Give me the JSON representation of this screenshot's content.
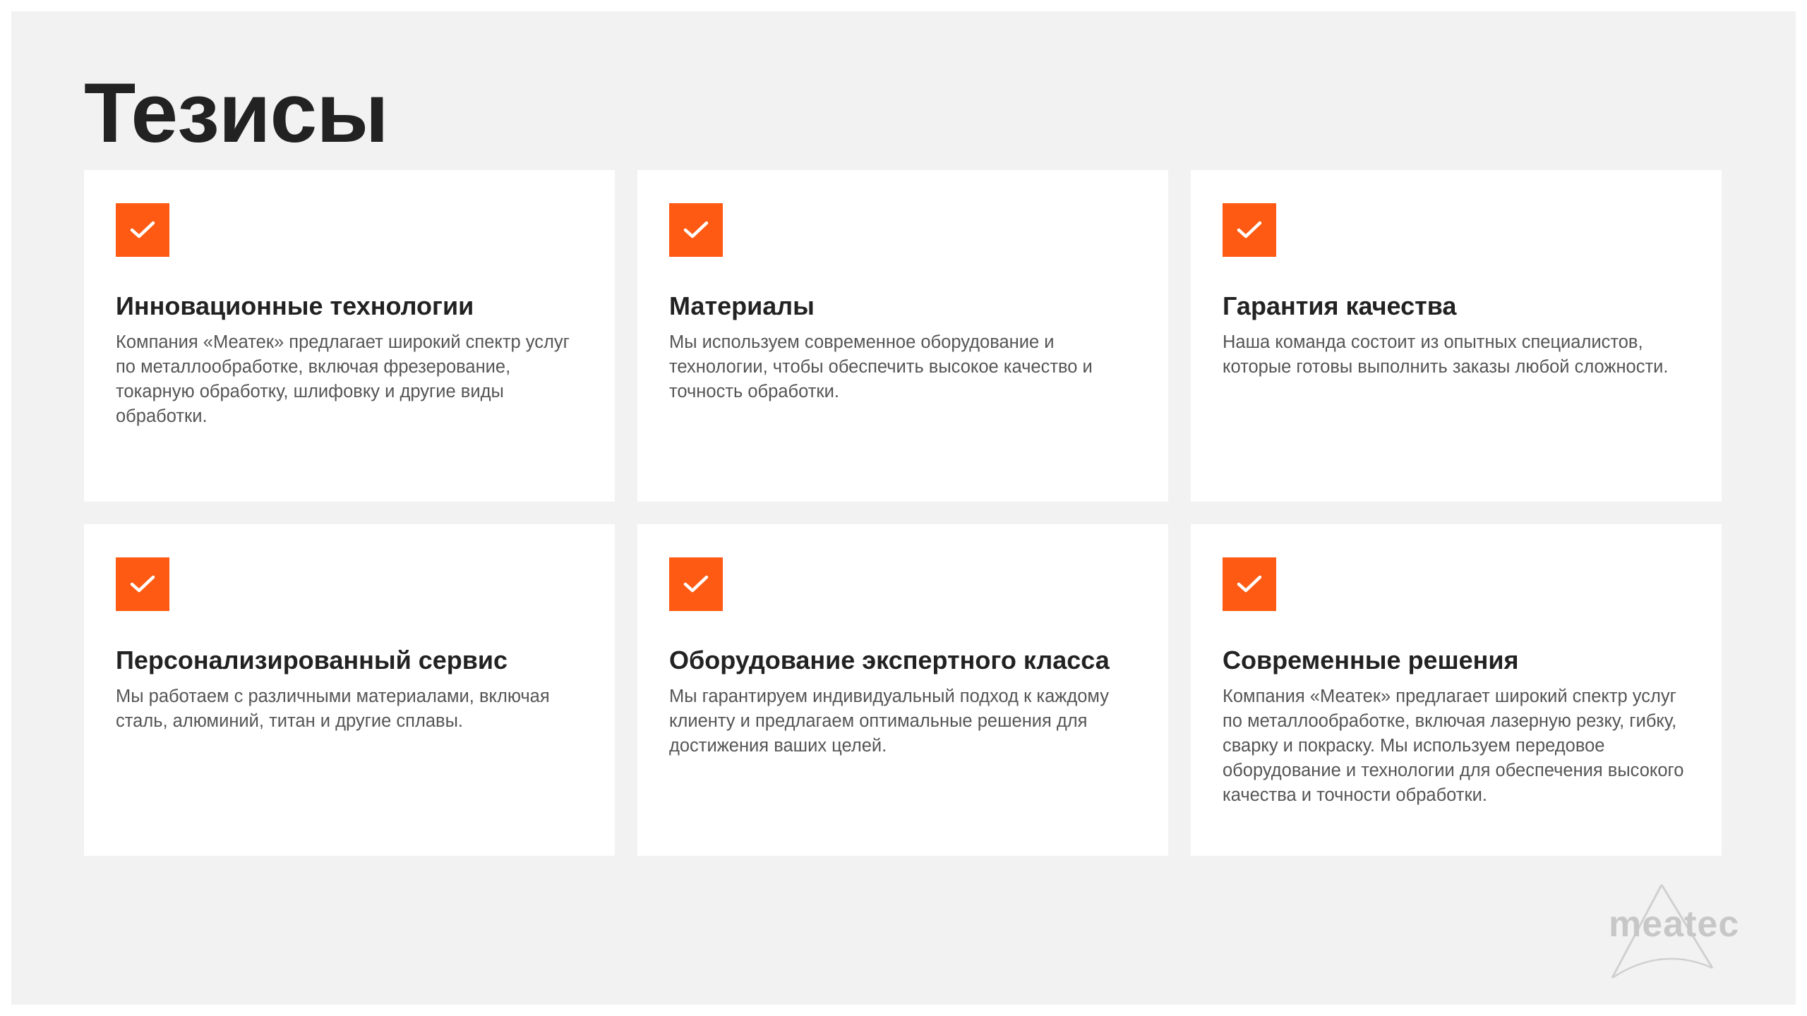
{
  "slide": {
    "title": "Тезисы"
  },
  "theme": {
    "accent": "#fe5a13",
    "background": "#f2f2f2",
    "card": "#ffffff",
    "title_color": "#222222",
    "text_color": "#555555",
    "logo_color": "#c7c7c7"
  },
  "cards": [
    {
      "icon": "checkmark-icon",
      "title": "Инновационные технологии",
      "text": "Компания «Меатек» предлагает широкий спектр услуг по металлообработке, включая фрезерование, токарную обработку, шлифовку и другие виды обработки."
    },
    {
      "icon": "checkmark-icon",
      "title": "Материалы",
      "text": "Мы используем современное оборудование и технологии, чтобы обеспечить высокое качество и точность обработки."
    },
    {
      "icon": "checkmark-icon",
      "title": "Гарантия качества",
      "text": "Наша команда состоит из опытных специалистов, которые готовы выполнить заказы любой сложности."
    },
    {
      "icon": "checkmark-icon",
      "title": "Персонализированный сервис",
      "text": "Мы работаем с различными материалами, включая сталь, алюминий, титан и другие сплавы."
    },
    {
      "icon": "checkmark-icon",
      "title": "Оборудование экспертного класса",
      "text": "Мы гарантируем индивидуальный подход к каждому клиенту и предлагаем оптимальные решения для достижения ваших целей."
    },
    {
      "icon": "checkmark-icon",
      "title": "Современные решения",
      "text": "Компания «Меатек» предлагает широкий спектр услуг по металлообработке, включая лазерную резку, гибку, сварку и покраску. Мы используем передовое оборудование и технологии для обеспечения высокого качества и точности обработки."
    }
  ],
  "logo": {
    "text": "meatec",
    "icon": "meatec-logo-icon"
  }
}
